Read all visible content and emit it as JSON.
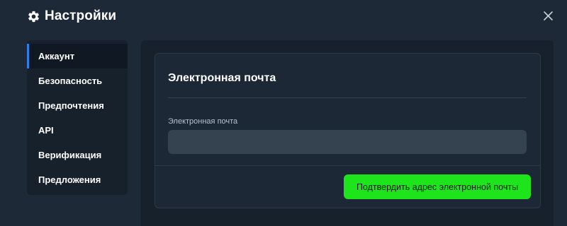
{
  "window": {
    "title": "Настройки",
    "title_icon": "gear-icon",
    "close_icon": "close-icon"
  },
  "sidebar": {
    "items": [
      {
        "label": "Аккаунт",
        "active": true
      },
      {
        "label": "Безопасность",
        "active": false
      },
      {
        "label": "Предпочтения",
        "active": false
      },
      {
        "label": "API",
        "active": false
      },
      {
        "label": "Верификация",
        "active": false
      },
      {
        "label": "Предложения",
        "active": false
      }
    ]
  },
  "email_section": {
    "title": "Электронная почта",
    "field_label": "Электронная почта",
    "field_value": "",
    "field_placeholder": "",
    "confirm_button_label": "Подтвердить адрес электронной почты"
  },
  "colors": {
    "background": "#1d2936",
    "panel": "#17212c",
    "active_indicator": "#2d7ff0",
    "confirm_button": "#1ee41b"
  }
}
